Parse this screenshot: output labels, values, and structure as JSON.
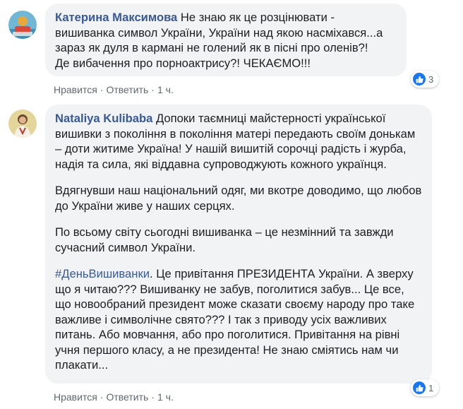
{
  "comments": [
    {
      "author": "Катерина Максимова",
      "text": " Не знаю як це розцінювати - вишиванка символ України, України над якою насміхався...а зараз як дуля в кармані не голений як в пісні про оленів?!\nДе вибачення про порноактрису?! ЧЕКАЄМО!!!",
      "like_label": "Нравится",
      "reply_label": "Ответить",
      "time": "1 ч.",
      "reaction_count": "3",
      "colors": {
        "avatar_bg": "#5fa9c9",
        "avatar_accent": "#e8a83a"
      }
    },
    {
      "author": "Nataliya Kulibaba",
      "paragraphs": [
        " Допоки таємниці майстерності української вишивки з покоління в покоління матері передають своїм донькам – доти житиме Україна! У нашій вишитій сорочці радість і журба, надія та сила, які віддавна супроводжують кожного українця.",
        "Вдягнувши наш національний одяг, ми вкотре доводимо, що любов до України живе у наших серцях.",
        "По всьому світу сьогодні вишиванка – це незмінний та завжди сучасний символ України."
      ],
      "hashtag": "#ДеньВишиванки",
      "last_paragraph": ". Це привітання ПРЕЗИДЕНТА України. А зверху що я читаю??? Вишиванку не забув, поголитися забув... Це все, що новообраний президент може сказати своєму народу про таке важливе і символічне свято??? І так з приводу усіх важливих питань. Або мовчання, або про поголитися. Привітання на рівні учня першого класу, а не президента! Не знаю сміятись нам чи плакати...",
      "like_label": "Нравится",
      "reply_label": "Ответить",
      "time": "1 ч.",
      "reaction_count": "1",
      "colors": {
        "avatar_bg": "#d9c98a",
        "avatar_accent": "#6b4a2e"
      }
    }
  ],
  "colors": {
    "link": "#385898",
    "bubble": "#f2f3f5",
    "meta": "#606770",
    "like_blue": "#1877f2"
  },
  "icons": [
    "like-icon"
  ]
}
